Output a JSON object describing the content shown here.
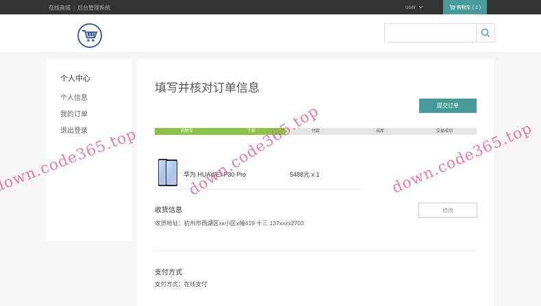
{
  "topbar": {
    "link_store": "在线商城",
    "separator": "|",
    "link_admin": "后台管理系统",
    "user_label": "user",
    "cart_label": "购物车 ( 1 )"
  },
  "header": {
    "logo_icon": "cart-logo-icon",
    "search": {
      "placeholder": "",
      "value": "",
      "icon": "search-icon"
    }
  },
  "sidebar": {
    "title": "个人中心",
    "items": [
      {
        "label": "个人信息"
      },
      {
        "label": "我的订单"
      },
      {
        "label": "退出登录"
      }
    ]
  },
  "main": {
    "title": "填写并核对订单信息",
    "submit_label": "提交订单",
    "progress": {
      "steps": [
        "购物车",
        "下单",
        "付款",
        "出库",
        "交易成功"
      ],
      "completed": 2
    },
    "product": {
      "name": "华为 HUAWEI P30 Pro",
      "price_qty": "5488元 x 1"
    },
    "shipping": {
      "title": "收货信息",
      "address": "收货地址：杭州市西湖区xx小区x幢419 十三 137xxxx2703",
      "edit_label": "修改"
    },
    "payment": {
      "title": "支付方式",
      "method": "支付方式：在线支付"
    }
  },
  "watermarks": [
    "down.code365.top",
    "down.code365.top",
    "down.code365.top"
  ],
  "colors": {
    "accent": "#4a9a9b",
    "progress_done": "#8bc34a",
    "topbar": "#333333",
    "watermark": "#e65a8c"
  }
}
